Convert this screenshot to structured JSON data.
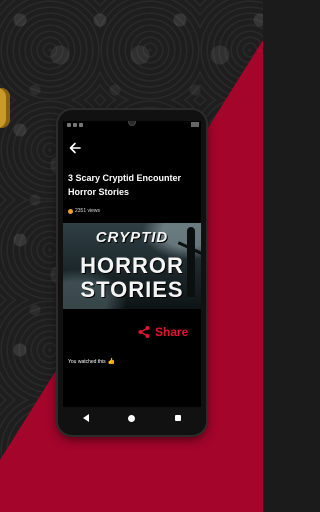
{
  "article": {
    "title": "3 Scary Cryptid Encounter Horror Stories",
    "views": "2351 views"
  },
  "thumbnail": {
    "line1": "CRYPTID",
    "line2": "HORROR",
    "line3": "STORIES"
  },
  "actions": {
    "share_label": "Share"
  },
  "footer": {
    "watched_text": "You watched this",
    "watched_emoji": "👍"
  },
  "icons": {
    "back": "back-arrow-icon",
    "share": "share-icon",
    "views": "views-icon"
  },
  "colors": {
    "accent": "#e3142d",
    "background_wedge": "#a3052b",
    "views_icon": "#f2a21b"
  }
}
